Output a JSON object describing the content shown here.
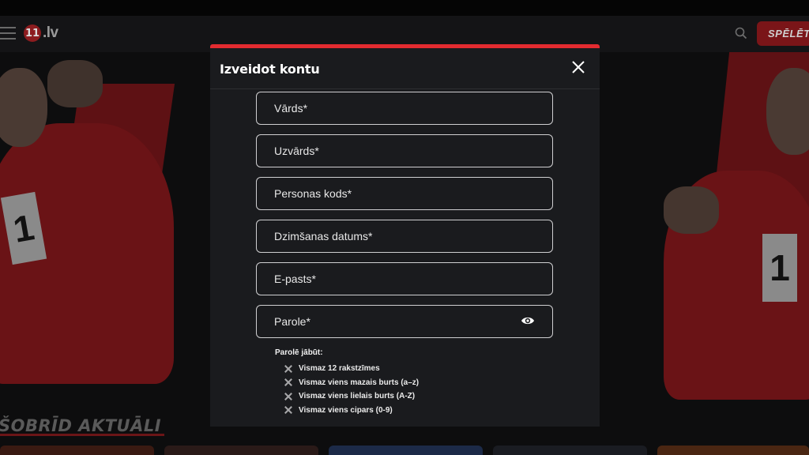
{
  "site": {
    "logo_ball": "11",
    "logo_text": ".lv",
    "play_button": "SPĒLĒT",
    "section_title": "ŠOBRĪD AKTUĀLI"
  },
  "hero": {
    "bib_number": "1"
  },
  "modal": {
    "title": "Izveidot kontu",
    "fields": [
      {
        "label": "Vārds*",
        "value": ""
      },
      {
        "label": "Uzvārds*",
        "value": ""
      },
      {
        "label": "Personas kods*",
        "value": ""
      },
      {
        "label": "Dzimšanas datums*",
        "value": ""
      },
      {
        "label": "E-pasts*",
        "value": ""
      },
      {
        "label": "Parole*",
        "value": ""
      }
    ],
    "password_rules": {
      "title": "Parolē jābūt:",
      "items": [
        "Vismaz 12 rakstzīmes",
        "Vismaz viens mazais burts (a–z)",
        "Vismaz viens lielais burts (A-Z)",
        "Vismaz viens cipars (0-9)"
      ]
    }
  },
  "colors": {
    "accent": "#e32b30",
    "modal_bg": "#1a1b1e",
    "field_border": "#cfcfd1"
  },
  "icons": [
    "menu-icon",
    "search-icon",
    "close-icon",
    "eye-icon",
    "x-mark-icon"
  ]
}
